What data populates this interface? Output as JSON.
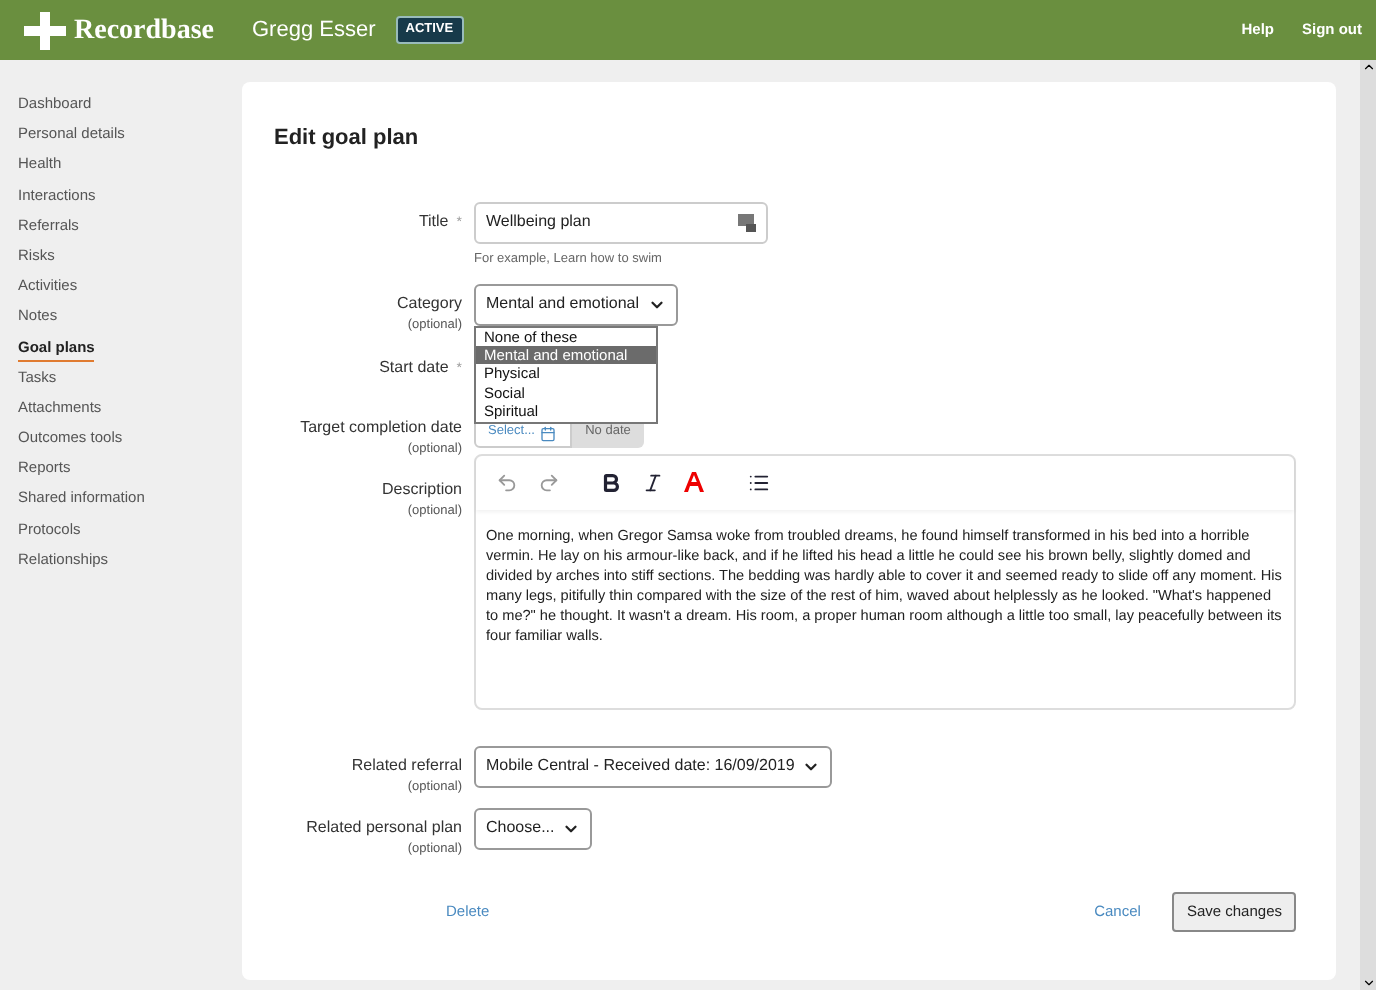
{
  "header": {
    "brand": "Recordbase",
    "person": "Gregg Esser",
    "status": "ACTIVE",
    "links": [
      "Help",
      "Sign out"
    ]
  },
  "sidebar": {
    "items": [
      {
        "label": "Dashboard",
        "selected": false
      },
      {
        "label": "Personal details",
        "selected": false
      },
      {
        "label": "Health",
        "selected": false
      },
      {
        "label": "Interactions",
        "selected": false
      },
      {
        "label": "Referrals",
        "selected": false
      },
      {
        "label": "Risks",
        "selected": false
      },
      {
        "label": "Activities",
        "selected": false
      },
      {
        "label": "Notes",
        "selected": false
      },
      {
        "label": "Goal plans",
        "selected": true
      },
      {
        "label": "Tasks",
        "selected": false
      },
      {
        "label": "Attachments",
        "selected": false
      },
      {
        "label": "Outcomes tools",
        "selected": false
      },
      {
        "label": "Reports",
        "selected": false
      },
      {
        "label": "Shared information",
        "selected": false
      },
      {
        "label": "Protocols",
        "selected": false
      },
      {
        "label": "Relationships",
        "selected": false
      }
    ]
  },
  "form": {
    "heading": "Edit goal plan",
    "title": {
      "label": "Title",
      "required_mark": "*",
      "value": "Wellbeing plan",
      "hint": "For example, Learn how to swim"
    },
    "category": {
      "label": "Category",
      "note": "(optional)",
      "value": "Mental and emotional",
      "options": [
        {
          "label": "None of these",
          "selected": false
        },
        {
          "label": "Mental and emotional",
          "selected": true
        },
        {
          "label": "Physical",
          "selected": false
        },
        {
          "label": "Social",
          "selected": false
        },
        {
          "label": "Spiritual",
          "selected": false
        }
      ]
    },
    "start_date": {
      "label": "Start date",
      "required_mark": "*"
    },
    "target_date": {
      "label": "Target completion date",
      "note": "(optional)",
      "placeholder": "Select...",
      "no_date": "No date"
    },
    "description": {
      "label": "Description",
      "note": "(optional)",
      "text": "One morning, when Gregor Samsa woke from troubled dreams, he found himself transformed in his bed into a horrible vermin. He lay on his armour-like back, and if he lifted his head a little he could see his brown belly, slightly domed and divided by arches into stiff sections. The bedding was hardly able to cover it and seemed ready to slide off any moment. His many legs, pitifully thin compared with the size of the rest of him, waved about helplessly as he looked. \"What's happened to me?\" he thought. It wasn't a dream. His room, a proper human room although a little too small, lay peacefully between its four familiar walls."
    },
    "related_referral": {
      "label": "Related referral",
      "note": "(optional)",
      "value": "Mobile Central - Received date: 16/09/2019"
    },
    "related_personal_plan": {
      "label": "Related personal plan",
      "note": "(optional)",
      "value": "Choose..."
    },
    "delete": "Delete",
    "cancel": "Cancel",
    "save": "Save changes"
  }
}
